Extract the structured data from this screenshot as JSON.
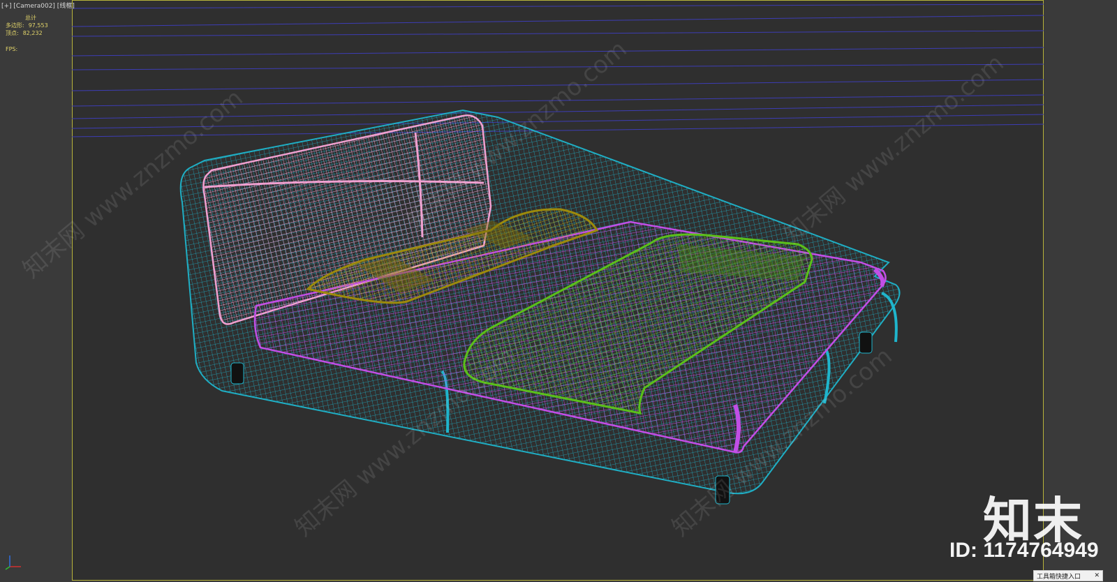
{
  "viewport": {
    "label": "[+] [Camera002] [线框]",
    "stats_header": "总计",
    "polys_label": "多边形:",
    "polys_value": "97,553",
    "verts_label": "顶点:",
    "verts_value": "82,232",
    "fps_label": "FPS:"
  },
  "watermark": {
    "text": "知末网 www.znzmo.com",
    "brand": "知末",
    "id": "ID: 1174764949"
  },
  "toolbox": {
    "label": "工具箱快捷入口",
    "close": "✕"
  },
  "colors": {
    "frame": "#b8b43a",
    "frame_cyan": "#1fb5cc",
    "headboard_pink": "#f0a0d0",
    "mattress_magenta": "#c24ee6",
    "pillow_olive": "#9c8a0c",
    "throw_green": "#5bbf1a",
    "grid_blue": "#3d3db5"
  },
  "icons": [
    "axis-gizmo-icon",
    "close-icon"
  ]
}
